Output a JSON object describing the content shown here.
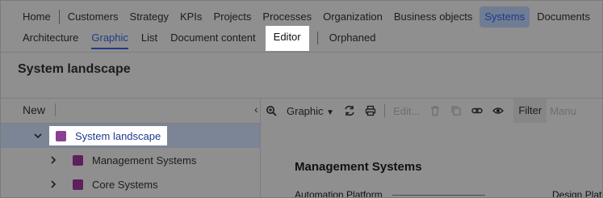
{
  "nav_primary": {
    "items": [
      "Home",
      "Customers",
      "Strategy",
      "KPIs",
      "Projects",
      "Processes",
      "Organization",
      "Business objects",
      "Systems",
      "Documents"
    ],
    "active": "Systems"
  },
  "nav_secondary": {
    "items": [
      "Architecture",
      "Graphic",
      "List",
      "Document content",
      "Editor",
      "Orphaned"
    ],
    "active": "Graphic",
    "highlighted": "Editor"
  },
  "page": {
    "title": "System landscape"
  },
  "tree": {
    "new_label": "New",
    "rows": [
      {
        "label": "System landscape",
        "expanded": true,
        "selected": true,
        "color": "#8a3f97"
      },
      {
        "label": "Management Systems",
        "expanded": false,
        "selected": false,
        "color": "#5e1f5e"
      },
      {
        "label": "Core Systems",
        "expanded": false,
        "selected": false,
        "color": "#5e1f5e"
      }
    ]
  },
  "toolbar": {
    "view_label": "Graphic",
    "edit_label": "Edit...",
    "filter_label": "Filter",
    "manual_label": "Manu",
    "icons": [
      "zoom-in-icon",
      "chevron-down-icon",
      "refresh-icon",
      "print-icon",
      "trash-icon",
      "copy-icon",
      "link-icon",
      "eye-icon"
    ]
  },
  "canvas": {
    "heading": "Management Systems",
    "left_label": "Automation Platform",
    "right_label": "Design Platf"
  },
  "colors": {
    "active_nav": "#1f3a8a",
    "selection": "#7c8596",
    "overlay": "#8f8f8f"
  }
}
